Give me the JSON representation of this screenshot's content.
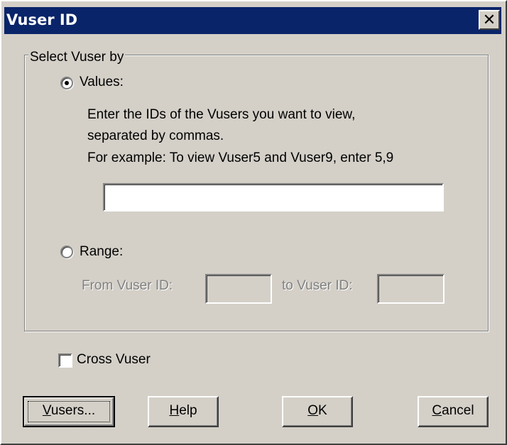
{
  "window": {
    "title": "Vuser ID",
    "close_glyph": "✕"
  },
  "group": {
    "legend": "Select Vuser by",
    "values_option": {
      "label": "Values:",
      "selected": true
    },
    "instructions": {
      "line1": "Enter the IDs of the Vusers you want to view,",
      "line2": "separated by commas.",
      "line3": "For example: To view Vuser5 and Vuser9, enter 5,9"
    },
    "values_input": {
      "value": ""
    },
    "range_option": {
      "label": "Range:",
      "selected": false
    },
    "range": {
      "from_label": "From Vuser ID:",
      "from_value": "",
      "to_label": "to Vuser ID:",
      "to_value": ""
    }
  },
  "cross_vuser": {
    "label": "Cross Vuser",
    "checked": false
  },
  "buttons": {
    "vusers": {
      "mnemonic": "V",
      "rest": "users..."
    },
    "help": {
      "mnemonic": "H",
      "rest": "elp"
    },
    "ok": {
      "mnemonic": "O",
      "rest": "K"
    },
    "cancel": {
      "mnemonic": "C",
      "rest": "ancel"
    }
  }
}
